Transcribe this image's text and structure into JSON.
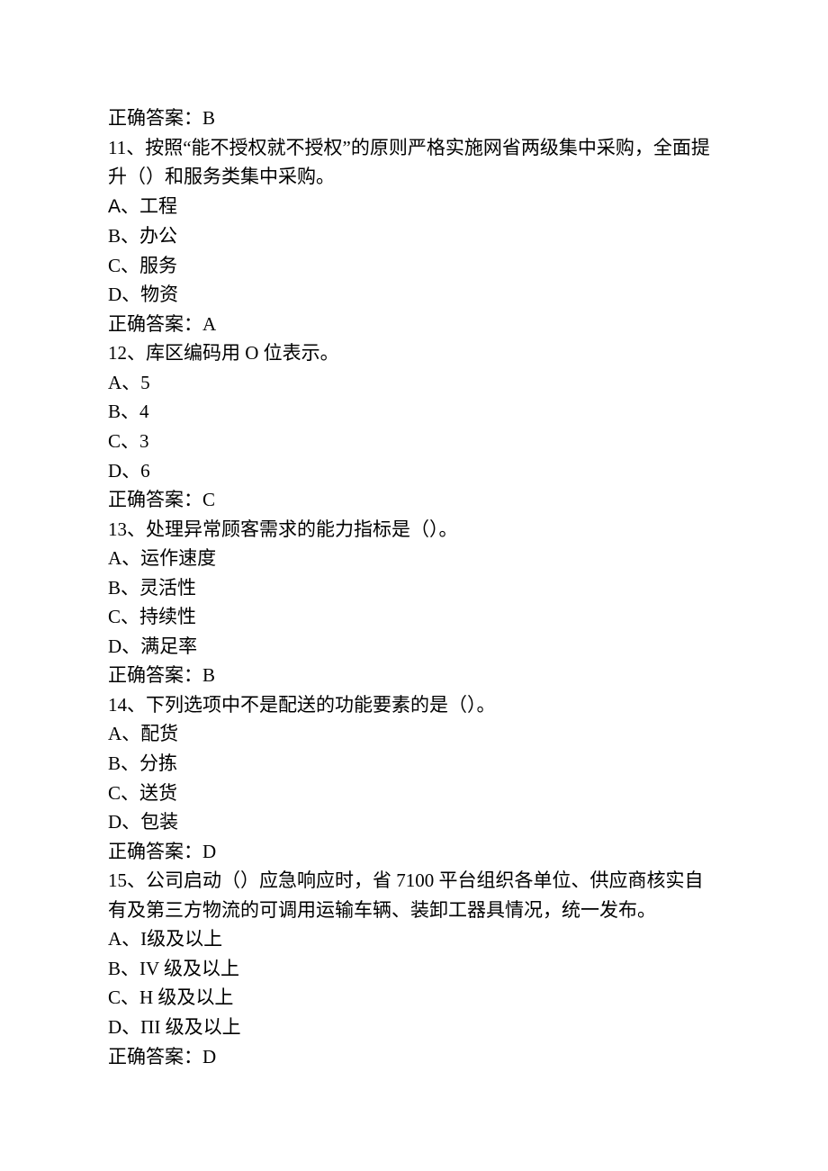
{
  "lines": [
    {
      "text": "正确答案：B"
    },
    {
      "text": "11、按照“能不授权就不授权”的原则严格实施网省两级集中采购，全面提升（）和服务类集中采购。"
    },
    {
      "text": "A、工程",
      "latinFirst": true
    },
    {
      "text": "B、办公"
    },
    {
      "text": "C、服务"
    },
    {
      "text": "D、物资"
    },
    {
      "text": "正确答案：A"
    },
    {
      "text": "12、库区编码用 O 位表示。"
    },
    {
      "text": "A、5"
    },
    {
      "text": "B、4"
    },
    {
      "text": "C、3"
    },
    {
      "text": "D、6"
    },
    {
      "text": "正确答案：C"
    },
    {
      "text": "13、处理异常顾客需求的能力指标是（）。"
    },
    {
      "text": "A、运作速度"
    },
    {
      "text": "B、灵活性"
    },
    {
      "text": "C、持续性"
    },
    {
      "text": "D、满足率"
    },
    {
      "text": "正确答案：B"
    },
    {
      "text": "14、下列选项中不是配送的功能要素的是（）。"
    },
    {
      "text": "A、配货"
    },
    {
      "text": "B、分拣"
    },
    {
      "text": "C、送货"
    },
    {
      "text": "D、包装"
    },
    {
      "text": "正确答案：D"
    },
    {
      "text": "15、公司启动（）应急响应时，省 7100 平台组织各单位、供应商核实自有及第三方物流的可调用运输车辆、装卸工器具情况，统一发布。"
    },
    {
      "text": "A、I级及以上"
    },
    {
      "text": "B、IV 级及以上"
    },
    {
      "text": "C、H 级及以上"
    },
    {
      "text": "D、ΠI 级及以上"
    },
    {
      "text": "正确答案：D"
    }
  ]
}
